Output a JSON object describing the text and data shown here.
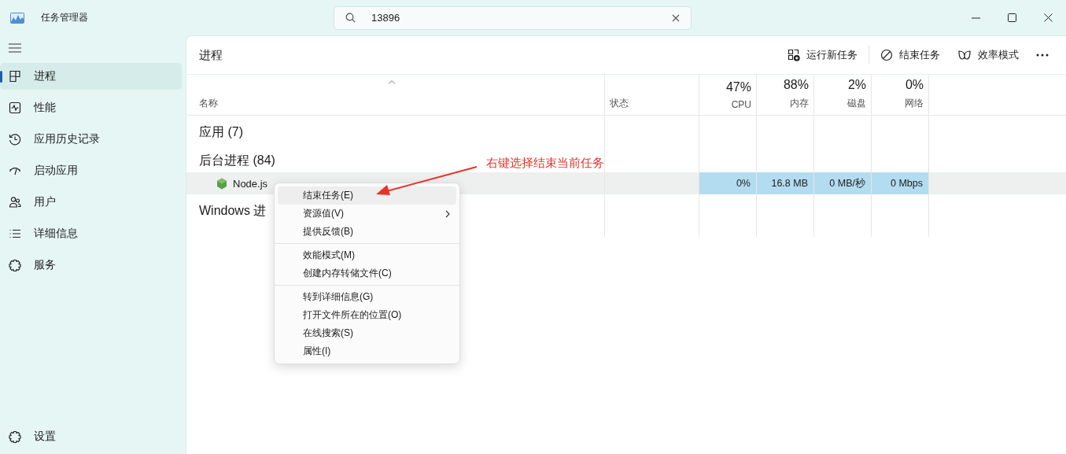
{
  "window": {
    "title": "任务管理器"
  },
  "search": {
    "value": "13896"
  },
  "sidebar": {
    "items": [
      {
        "label": "进程",
        "selected": true
      },
      {
        "label": "性能",
        "selected": false
      },
      {
        "label": "应用历史记录",
        "selected": false
      },
      {
        "label": "启动应用",
        "selected": false
      },
      {
        "label": "用户",
        "selected": false
      },
      {
        "label": "详细信息",
        "selected": false
      },
      {
        "label": "服务",
        "selected": false
      }
    ],
    "footer": {
      "label": "设置"
    }
  },
  "page": {
    "title": "进程",
    "toolbar": [
      "运行新任务",
      "结束任务",
      "效率模式"
    ]
  },
  "table": {
    "columns": [
      {
        "label": "名称"
      },
      {
        "label": "状态"
      },
      {
        "label": "CPU",
        "total": "47%"
      },
      {
        "label": "内存",
        "total": "88%"
      },
      {
        "label": "磁盘",
        "total": "2%"
      },
      {
        "label": "网络",
        "total": "0%"
      }
    ],
    "groups": [
      {
        "title": "应用 (7)"
      },
      {
        "title": "后台进程 (84)",
        "rows": [
          {
            "name": "Node.js",
            "selected": true,
            "values": [
              "0%",
              "16.8 MB",
              "0 MB/秒",
              "0 Mbps"
            ]
          }
        ]
      },
      {
        "title": "Windows 进"
      }
    ]
  },
  "context_menu": {
    "groups": [
      [
        {
          "label": "结束任务(E)",
          "selected": true,
          "submenu": false
        },
        {
          "label": "资源值(V)",
          "selected": false,
          "submenu": true
        },
        {
          "label": "提供反馈(B)",
          "selected": false,
          "submenu": false
        }
      ],
      [
        {
          "label": "效能模式(M)",
          "selected": false,
          "submenu": false
        },
        {
          "label": "创建内存转储文件(C)",
          "selected": false,
          "submenu": false
        }
      ],
      [
        {
          "label": "转到详细信息(G)",
          "selected": false,
          "submenu": false
        },
        {
          "label": "打开文件所在的位置(O)",
          "selected": false,
          "submenu": false
        },
        {
          "label": "在线搜索(S)",
          "selected": false,
          "submenu": false
        },
        {
          "label": "属性(I)",
          "selected": false,
          "submenu": false
        }
      ]
    ]
  },
  "annotation": {
    "text": "右键选择结束当前任务"
  }
}
